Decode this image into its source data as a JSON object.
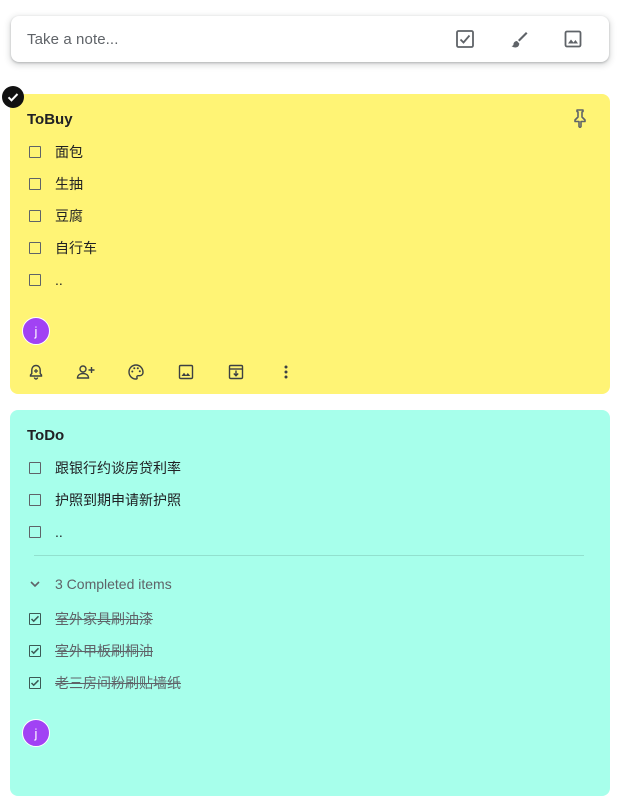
{
  "take_note": {
    "placeholder": "Take a note...",
    "icons": [
      "checkbox-list-icon",
      "brush-icon",
      "image-icon"
    ]
  },
  "notes": [
    {
      "title": "ToBuy",
      "color": "#fff475",
      "pinned": false,
      "selected": true,
      "items": [
        {
          "text": "面包",
          "checked": false
        },
        {
          "text": "生抽",
          "checked": false
        },
        {
          "text": "豆腐",
          "checked": false
        },
        {
          "text": "自行车",
          "checked": false
        },
        {
          "text": "..",
          "checked": false
        }
      ],
      "collaborator_initial": "j",
      "toolbar_icons": [
        "reminder-icon",
        "collaborator-icon",
        "palette-icon",
        "image-icon",
        "archive-icon",
        "more-icon"
      ]
    },
    {
      "title": "ToDo",
      "color": "#a7ffeb",
      "items": [
        {
          "text": "跟银行约谈房贷利率",
          "checked": false
        },
        {
          "text": "护照到期申请新护照",
          "checked": false
        },
        {
          "text": "..",
          "checked": false
        }
      ],
      "completed_label": "3 Completed items",
      "completed_items": [
        {
          "text": "室外家具刷油漆",
          "checked": true
        },
        {
          "text": "室外甲板刷桐油",
          "checked": true
        },
        {
          "text": "老三房间粉刷贴墙纸",
          "checked": true
        }
      ],
      "collaborator_initial": "j"
    }
  ],
  "colors": {
    "avatar": "#a142f4",
    "selected_check": "#111111"
  }
}
